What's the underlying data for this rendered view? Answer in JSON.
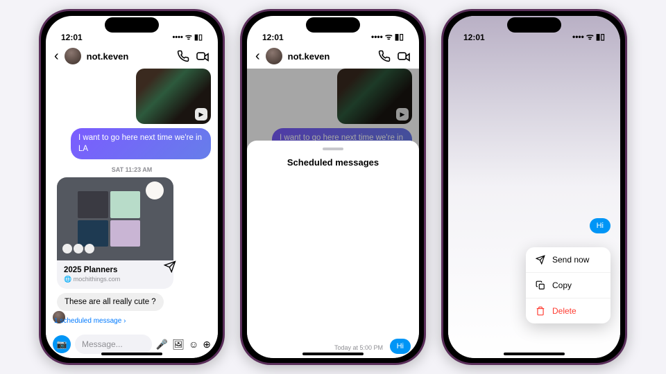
{
  "statusbar": {
    "time": "12:01"
  },
  "chat": {
    "username": "not.keven"
  },
  "messages": {
    "sent_text": "I want to go here next time we're in LA",
    "timestamp": "SAT 11:23 AM",
    "card_title": "2025 Planners",
    "card_sub": "mochithings.com",
    "reply": "These are all really cute ?"
  },
  "scheduled": {
    "row": "1 scheduled message  ›",
    "sheet_title": "Scheduled messages",
    "time": "Today at 5:00 PM",
    "bubble": "Hi"
  },
  "input": {
    "placeholder": "Message..."
  },
  "context": {
    "bubble": "Hi",
    "send": "Send now",
    "copy": "Copy",
    "delete": "Delete"
  }
}
